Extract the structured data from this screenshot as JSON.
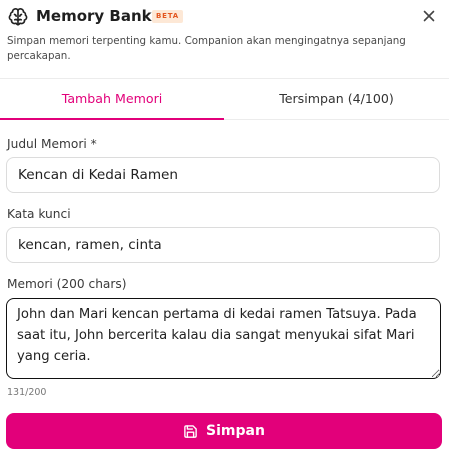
{
  "header": {
    "title": "Memory Bank",
    "badge": "BETA",
    "subtitle": "Simpan memori terpenting kamu. Companion akan mengingatnya sepanjang percakapan.",
    "icon": "brain-icon",
    "close_icon": "close-icon"
  },
  "tabs": [
    {
      "label": "Tambah Memori",
      "active": true
    },
    {
      "label": "Tersimpan (4/100)",
      "active": false
    }
  ],
  "form": {
    "title_label": "Judul Memori *",
    "title_value": "Kencan di Kedai Ramen",
    "keywords_label": "Kata kunci",
    "keywords_value": "kencan, ramen, cinta",
    "memory_label": "Memori (200 chars)",
    "memory_value": "John dan Mari kencan pertama di kedai ramen Tatsuya. Pada saat itu, John bercerita kalau dia sangat menyukai sifat Mari yang ceria.",
    "char_counter": "131/200",
    "save_label": "Simpan",
    "save_icon": "save-icon"
  },
  "colors": {
    "accent": "#e2007a",
    "badge_bg": "#fde8d6",
    "badge_text": "#e3561f"
  }
}
